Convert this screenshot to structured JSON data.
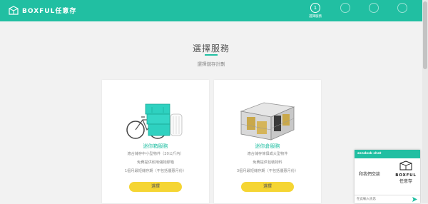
{
  "header": {
    "brand_name": "BOXFUL任意存",
    "steps": [
      {
        "number": "1",
        "label": "選擇服務",
        "active": true
      },
      {
        "number": "",
        "label": "",
        "active": false
      },
      {
        "number": "",
        "label": "",
        "active": false
      },
      {
        "number": "",
        "label": "",
        "active": false
      }
    ]
  },
  "main": {
    "title": "選擇服務",
    "subtitle": "選擇儲存計劃",
    "cards": [
      {
        "name": "迷你箱服務",
        "descriptions": [
          "適合儲存中小型物件（20公斤內）",
          "免費提供耐用儲物膠箱",
          "1個月最短儲存期（不包括優惠月份）"
        ],
        "button_label": "選擇"
      },
      {
        "name": "迷你倉服務",
        "descriptions": [
          "適合儲存傢俱或大型物件",
          "免費提供包裝物料",
          "3個月最短儲存期（不包括優惠月份）"
        ],
        "button_label": "選擇"
      }
    ]
  },
  "chat": {
    "header": "zendesk chat",
    "message": "和我們交談",
    "brand": "BOXFUL",
    "brand_sub": "任意存",
    "input_placeholder": "在此輸入訊息"
  },
  "colors": {
    "brand": "#21bfa2",
    "button": "#f5d533",
    "background": "#f2f2f2"
  },
  "icons": [
    "box-logo-icon",
    "step-circle-icon",
    "send-icon"
  ]
}
